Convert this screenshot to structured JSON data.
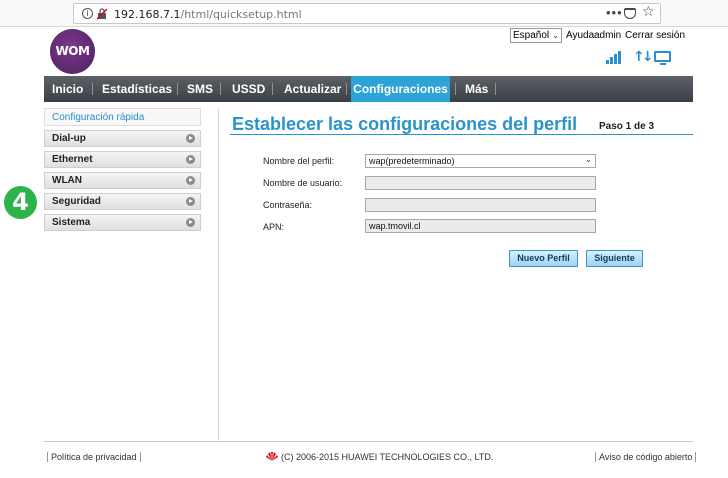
{
  "browser": {
    "url_host": "192.168.7.1",
    "url_path": "/html/quicksetup.html",
    "more_glyph": "•••",
    "star_glyph": "☆",
    "info_glyph": "i"
  },
  "header": {
    "logo_text": "WOM",
    "language": "Español",
    "links": [
      "Ayuda",
      "admin",
      "Cerrar sesión"
    ]
  },
  "nav": {
    "items": [
      "Inicio",
      "Estadísticas",
      "SMS",
      "USSD",
      "Actualizar",
      "Configuraciones",
      "Más"
    ],
    "active": "Configuraciones"
  },
  "sidebar": {
    "items": [
      "Configuración rápida",
      "Dial-up",
      "Ethernet",
      "WLAN",
      "Seguridad",
      "Sistema"
    ],
    "active": "Configuración rápida"
  },
  "step_badge": "4",
  "main": {
    "title": "Establecer las configuraciones del perfil",
    "step": "Paso 1 de 3",
    "fields": [
      {
        "label": "Nombre del perfil:",
        "value": "wap(predeterminado)"
      },
      {
        "label": "Nombre de usuario:",
        "value": ""
      },
      {
        "label": "Contraseña:",
        "value": ""
      },
      {
        "label": "APN:",
        "value": "wap.tmovil.cl"
      }
    ],
    "buttons": {
      "new_profile": "Nuevo Perfil",
      "next": "Siguiente"
    }
  },
  "footer": {
    "privacy": "Política de privacidad",
    "copyright": "(C) 2006-2015 HUAWEI TECHNOLOGIES CO., LTD.",
    "open_source": "Aviso de código abierto"
  },
  "colors": {
    "accent": "#2ea3d8",
    "title": "#2a93cc",
    "nav_bg": "#4a5055",
    "badge": "#2db34a",
    "logo": "#5a2770"
  }
}
